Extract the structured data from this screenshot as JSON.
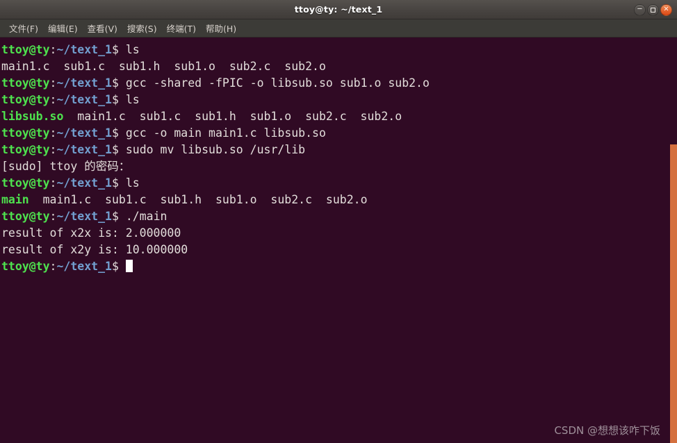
{
  "window": {
    "title": "ttoy@ty: ~/text_1",
    "controls": {
      "minimize_label": "−",
      "maximize_label": "",
      "close_label": "×"
    }
  },
  "menubar": {
    "items": [
      {
        "label": "文件(F)"
      },
      {
        "label": "编辑(E)"
      },
      {
        "label": "查看(V)"
      },
      {
        "label": "搜索(S)"
      },
      {
        "label": "终端(T)"
      },
      {
        "label": "帮助(H)"
      }
    ]
  },
  "terminal": {
    "prompt": {
      "user_host": "ttoy@ty",
      "separator": ":",
      "path": "~/text_1",
      "sigil": "$"
    },
    "colors": {
      "background": "#300a24",
      "foreground": "#e3dedb",
      "green": "#4ee24e",
      "blue": "#729fcf",
      "cursor": "#ffffff",
      "scrollbar": "#d4703f"
    },
    "lines": [
      {
        "type": "prompt",
        "command": " ls"
      },
      {
        "type": "output",
        "text": "main1.c  sub1.c  sub1.h  sub1.o  sub2.c  sub2.o"
      },
      {
        "type": "prompt",
        "command": " gcc -shared -fPIC -o libsub.so sub1.o sub2.o"
      },
      {
        "type": "prompt",
        "command": " ls"
      },
      {
        "type": "output-green-first",
        "green": "libsub.so",
        "text": "  main1.c  sub1.c  sub1.h  sub1.o  sub2.c  sub2.o"
      },
      {
        "type": "prompt",
        "command": " gcc -o main main1.c libsub.so"
      },
      {
        "type": "prompt",
        "command": " sudo mv libsub.so /usr/lib"
      },
      {
        "type": "output",
        "text": "[sudo] ttoy 的密码："
      },
      {
        "type": "prompt",
        "command": " ls"
      },
      {
        "type": "output-green-first",
        "green": "main",
        "text": "  main1.c  sub1.c  sub1.h  sub1.o  sub2.c  sub2.o"
      },
      {
        "type": "prompt",
        "command": " ./main"
      },
      {
        "type": "output",
        "text": "result of x2x is: 2.000000"
      },
      {
        "type": "output",
        "text": "result of x2y is: 10.000000"
      },
      {
        "type": "prompt-cursor",
        "command": " "
      }
    ]
  },
  "watermark": {
    "text": "CSDN @想想该咋下饭"
  }
}
